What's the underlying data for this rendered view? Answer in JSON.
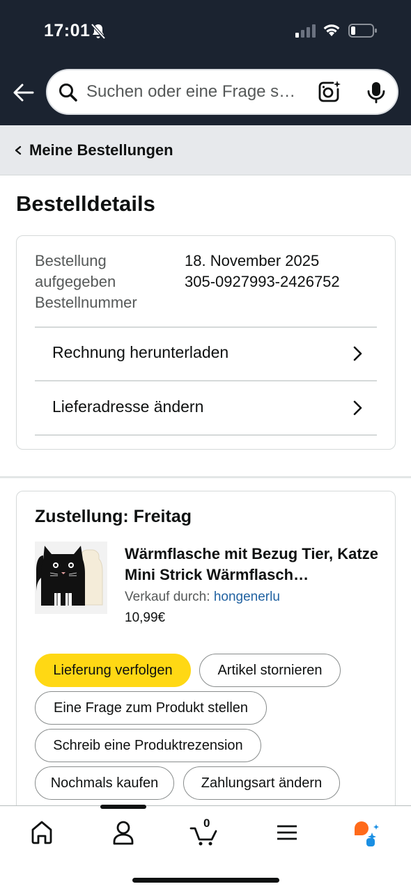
{
  "status_bar": {
    "time": "17:01"
  },
  "search": {
    "placeholder": "Suchen oder eine Frage s…"
  },
  "breadcrumb": {
    "label": "Meine Bestellungen"
  },
  "page": {
    "title": "Bestelldetails"
  },
  "order_summary": {
    "placed_label": "Bestellung aufgegeben",
    "placed_label_line1": "Bestellung",
    "placed_label_line2": "aufgegeben",
    "placed_value": "18. November 2025",
    "number_label": "Bestellnummer",
    "number_value": "305-0927993-2426752",
    "actions": [
      {
        "label": "Rechnung herunterladen"
      },
      {
        "label": "Lieferadresse ändern"
      }
    ]
  },
  "shipment": {
    "heading": "Zustellung: Freitag",
    "product": {
      "title": "Wärmflasche mit Bezug Tier, Katze Mini Strick Wärmflasch…",
      "sold_by_prefix": "Verkauf durch:",
      "seller": "hongenerlu",
      "price": "10,99€"
    },
    "buttons": [
      {
        "label": "Lieferung verfolgen"
      },
      {
        "label": "Artikel stornieren"
      },
      {
        "label": "Eine Frage zum Produkt stellen"
      },
      {
        "label": "Schreib eine Produktrezension"
      },
      {
        "label": "Nochmals kaufen"
      },
      {
        "label": "Zahlungsart ändern"
      }
    ]
  },
  "tab_bar": {
    "cart_count": "0",
    "tabs": [
      "home-icon",
      "account-icon",
      "cart-icon",
      "menu-icon",
      "rufus-icon"
    ]
  },
  "colors": {
    "header_bg": "#1b2330",
    "primary_button": "#ffd814",
    "link": "#2162a1",
    "assistant_orange": "#ff6a1a",
    "assistant_blue": "#1a8fe3"
  }
}
